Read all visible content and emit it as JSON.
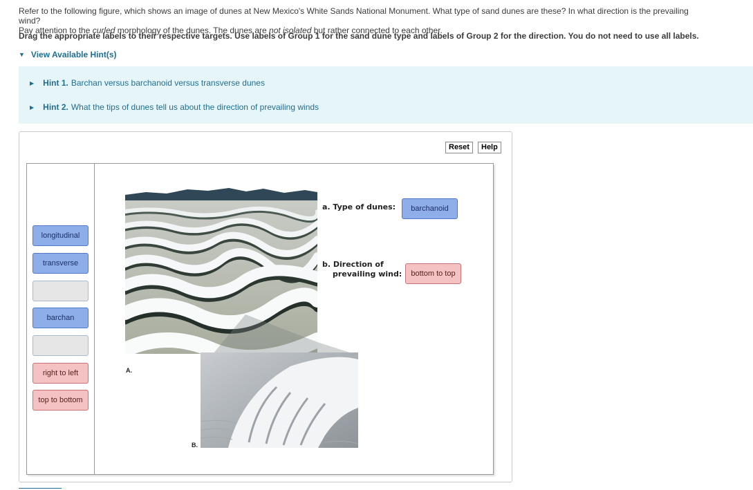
{
  "question": {
    "line1": "Refer to the following figure, which shows an image of dunes at New Mexico's White Sands National Monument. What type of sand dunes are these? In what direction is the prevailing wind?",
    "line2_a": "Pay attention to the ",
    "line2_em1": "curled",
    "line2_b": " morphology of the dunes. The dunes are ",
    "line2_em2": "not isolated",
    "line2_c": " but rather connected to each other."
  },
  "instructions": "Drag the appropriate labels to their respective targets. Use labels of Group 1 for the sand dune type and labels of Group 2 for the direction. You do not need to use all labels.",
  "hints": {
    "toggle_label": "View Available Hint(s)",
    "items": [
      {
        "num": "Hint 1.",
        "text": "Barchan versus barchanoid versus transverse dunes"
      },
      {
        "num": "Hint 2.",
        "text": "What the tips of dunes tell us about the direction of prevailing winds"
      }
    ]
  },
  "toolbar": {
    "reset_label": "Reset",
    "help_label": "Help"
  },
  "labels": [
    {
      "text": "longitudinal",
      "group": 1
    },
    {
      "text": "transverse",
      "group": 1
    },
    {
      "text": "",
      "group": 1
    },
    {
      "text": "barchan",
      "group": 1
    },
    {
      "text": "",
      "group": 1
    },
    {
      "text": "right to left",
      "group": 2
    },
    {
      "text": "top to bottom",
      "group": 2
    }
  ],
  "figure": {
    "label_a": "A.",
    "label_b": "B."
  },
  "targets": {
    "a": {
      "prompt": "a. Type of dunes:",
      "placed": "barchanoid"
    },
    "b": {
      "prompt_line1": "b. Direction of",
      "prompt_line2": "prevailing wind:",
      "placed": "bottom to top"
    }
  },
  "colors": {
    "group1": "#8eaeea",
    "group2": "#f4c2c2",
    "hint_bg": "#e6f5f7",
    "link": "#1f6e93"
  }
}
